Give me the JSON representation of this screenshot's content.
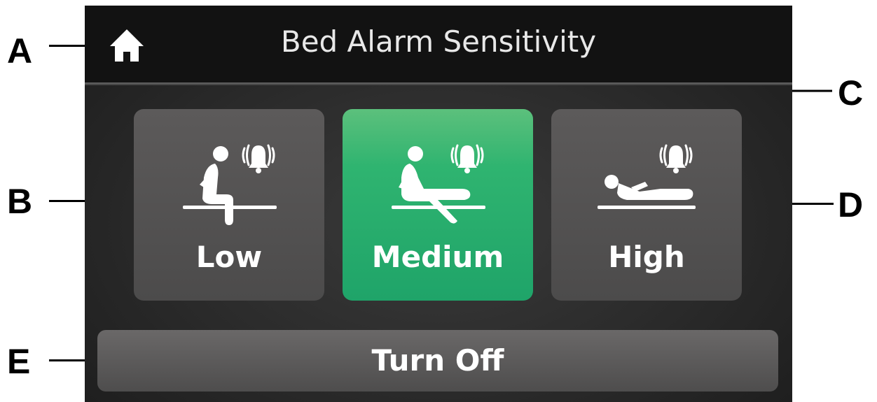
{
  "header": {
    "title": "Bed Alarm Sensitivity",
    "home_icon": "home-icon"
  },
  "options": [
    {
      "label": "Low",
      "icon": "patient-sitting-edge-alarm-icon",
      "selected": false
    },
    {
      "label": "Medium",
      "icon": "patient-sitting-up-alarm-icon",
      "selected": true
    },
    {
      "label": "High",
      "icon": "patient-lying-alarm-icon",
      "selected": false
    }
  ],
  "turn_off": {
    "label": "Turn Off"
  },
  "callouts": [
    "A",
    "B",
    "C",
    "D",
    "E"
  ],
  "colors": {
    "selected": "#2fb470",
    "option": "#555454",
    "header": "#121212"
  }
}
